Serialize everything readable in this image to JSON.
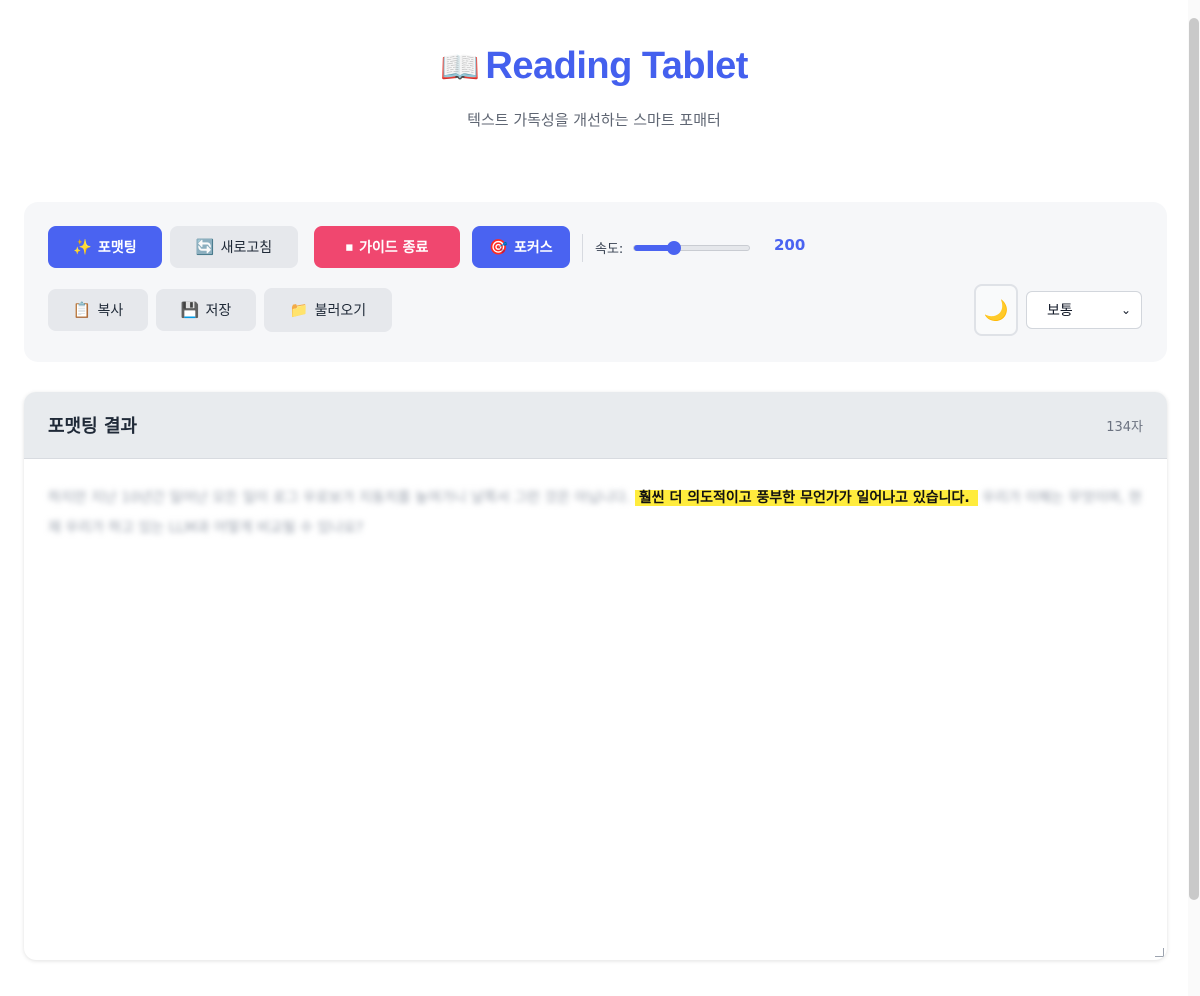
{
  "header": {
    "icon": "open-book-icon",
    "title": "Reading Tablet",
    "subtitle": "텍스트 가독성을 개선하는 스마트 포매터"
  },
  "toolbar": {
    "format_icon": "✨",
    "format_label": "포맷팅",
    "refresh_icon": "🔄",
    "refresh_label": "새로고침",
    "guide_icon": "⏹",
    "guide_label": "가이드 종료",
    "focus_icon": "🎯",
    "focus_label": "포커스",
    "speed_label": "속도:",
    "speed_value": "200",
    "speed_slider_fraction": 0.35,
    "copy_icon": "📋",
    "copy_label": "복사",
    "save_icon": "💾",
    "save_label": "저장",
    "load_icon": "📁",
    "load_label": "불러오기",
    "theme_icon": "🌙",
    "size_selected": "보통"
  },
  "result": {
    "title": "포맷팅 결과",
    "char_count": "134자",
    "text_before": "하지만 지난 10년간 일어난 모든 일이 로그 우로보가 지동치를 높여가니 날쪽서 그런 것은 아닙니다.",
    "focus_sentence": "훨씬 더 의도적이고 풍부한 무언가가 일어나고 있습니다.",
    "text_after": "우리가 이해는 무엇이며, 현재 우리가 하고 있는 LLM과 어떻게 비교될 수 있나요?"
  },
  "colors": {
    "accent": "#4a63f1",
    "danger": "#f0476f",
    "highlight": "#ffec3d"
  }
}
